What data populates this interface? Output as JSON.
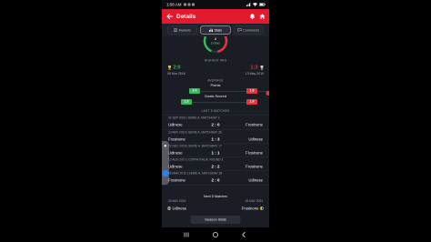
{
  "status_bar": {
    "time": "1:58 AM"
  },
  "header": {
    "title": "Details"
  },
  "tabs": [
    {
      "label": "Markets",
      "icon": "markets-icon",
      "selected": false
    },
    {
      "label": "Stats",
      "icon": "stats-icon",
      "selected": true
    },
    {
      "label": "Comments",
      "icon": "comments-icon",
      "selected": false
    }
  ],
  "head_to_head": {
    "draws_count": "2",
    "draws_label": "Draws"
  },
  "highest_win": {
    "title": "HIGHEST WIN",
    "home": {
      "score": "2:0",
      "date": "06 Mar 2016"
    },
    "away": {
      "score": "1:3",
      "date": "13 May 2019"
    }
  },
  "average": {
    "title": "AVERAGE",
    "points": {
      "label": "Points",
      "home": "2.4",
      "away": "1.6"
    },
    "goals": {
      "label": "Goals Scored",
      "home": "1.3",
      "away": "1.6"
    }
  },
  "last_matches": {
    "title": "LAST 5 MATCHES",
    "items": [
      {
        "meta": "02 SEP 2023 | SERIE A, MATCHDAY 3",
        "home": "Udinese",
        "score": "2 : 0",
        "away": "Frosinone"
      },
      {
        "meta": "13 MAY 2019 | SERIE A, MATCHDAY 36",
        "home": "Frosinone",
        "score": "1 : 3",
        "away": "Udinese"
      },
      {
        "meta": "22 DEC 2018 | SERIE A, MATCHDAY 17",
        "home": "Udinese",
        "score": "1 : 1",
        "away": "Frosinone"
      },
      {
        "meta": "12 AUG 2017 | COPPA ITALIA, ROUND 3",
        "home": "Udinese",
        "score": "2 : 2",
        "away": "Frosinone"
      },
      {
        "meta": "06 MAR 2016 | SERIE A, MATCHDAY 28",
        "home": "Frosinone",
        "score": "2 : 0",
        "away": "Udinese"
      }
    ]
  },
  "next_matches": {
    "title": "Next 5 Matches",
    "items": [
      {
        "date": "26 MAY 2024",
        "date_right": "26 MAY 2024",
        "home": "Udinese",
        "away": "Frosinone"
      }
    ]
  },
  "season_stats_button": "Season Stats",
  "icons": {
    "back": "arrow-left-icon",
    "bell": "bell-icon",
    "home": "home-icon",
    "trophy": "trophy-icon",
    "nav": [
      "recent-apps-icon",
      "home-circle-icon",
      "nav-back-icon"
    ]
  },
  "colors": {
    "accent": "#e3192d",
    "home": "#35b857",
    "away": "#e0363c",
    "background": "#1b1d24"
  }
}
